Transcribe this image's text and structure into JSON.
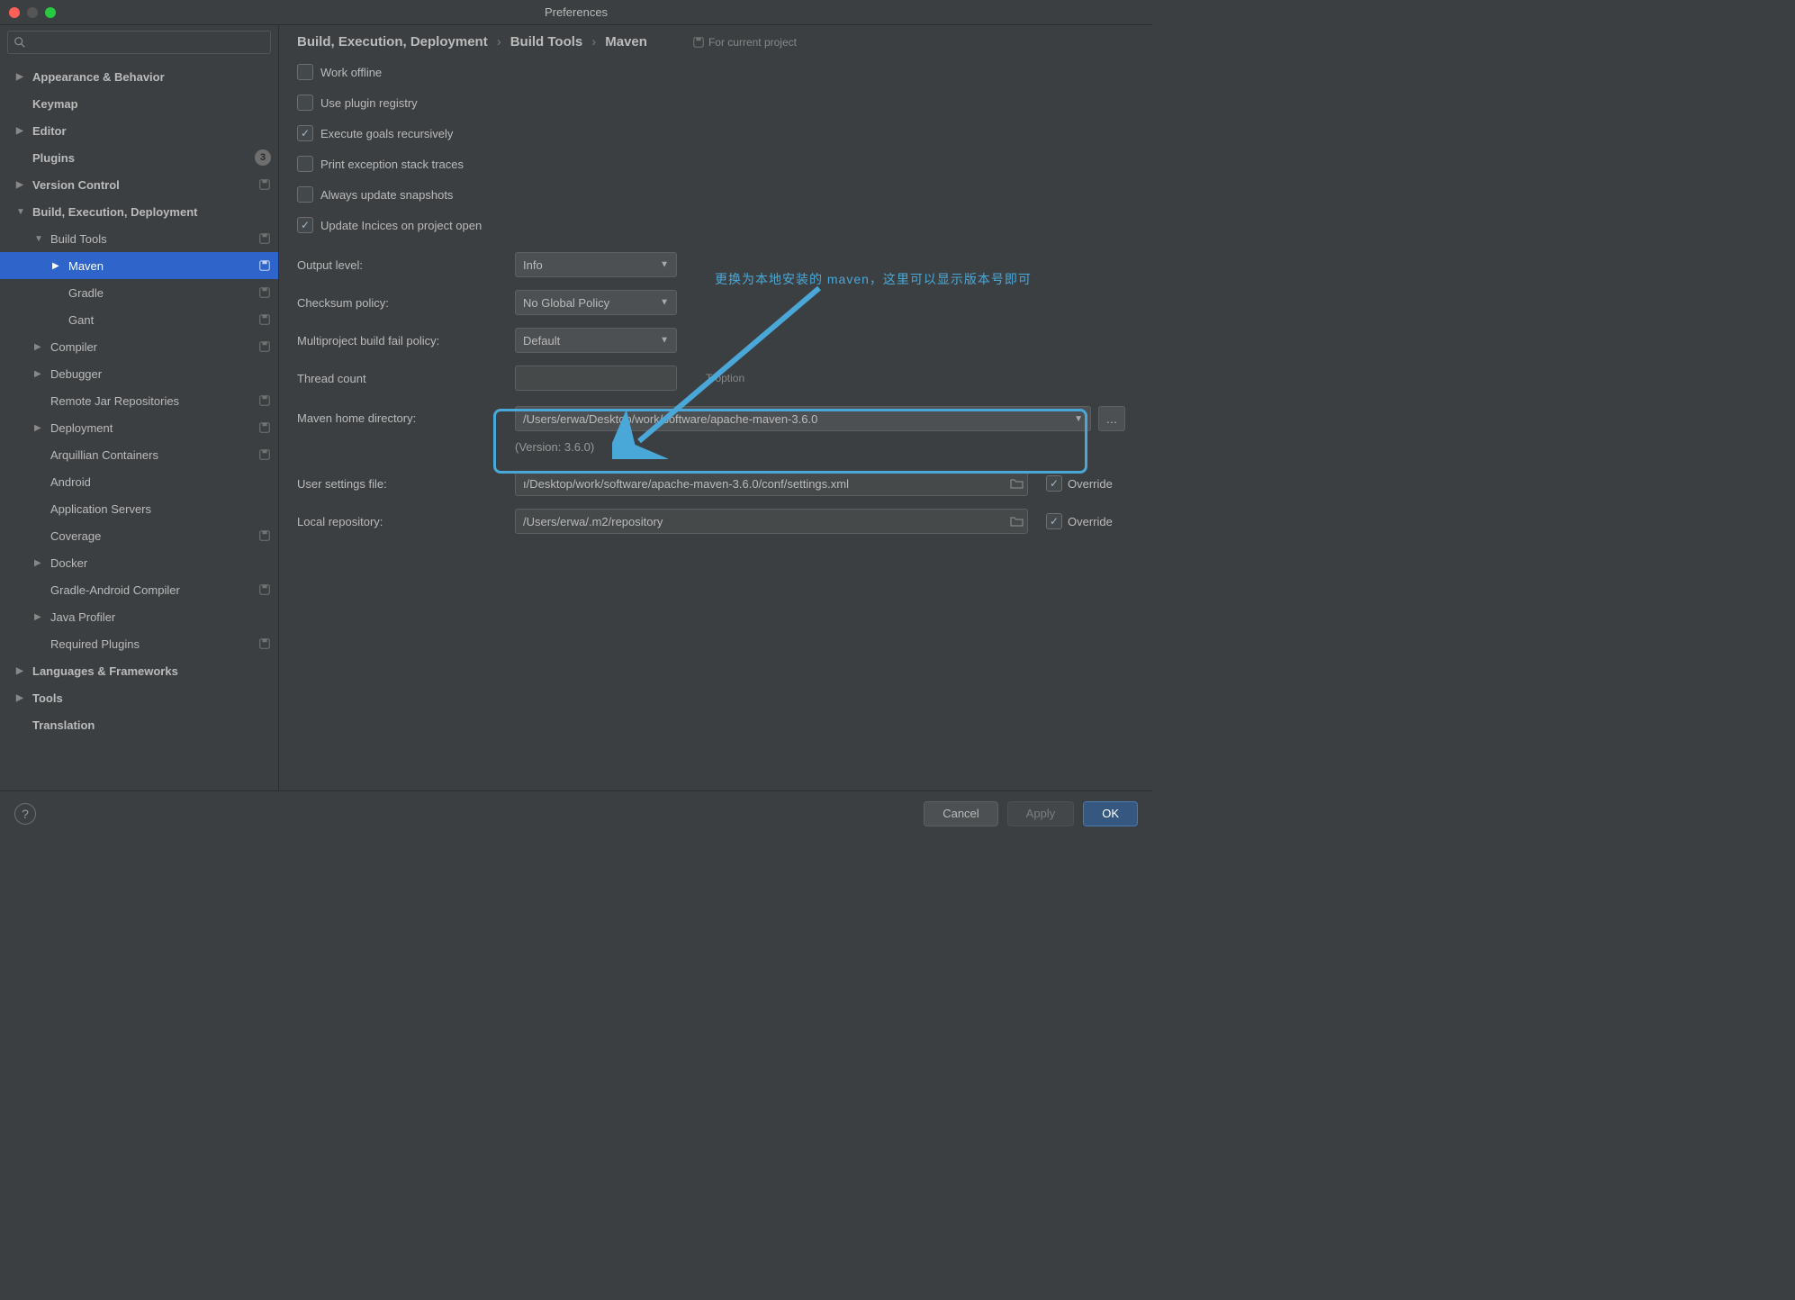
{
  "window": {
    "title": "Preferences"
  },
  "search": {
    "placeholder": ""
  },
  "sidebar": [
    {
      "label": "Appearance & Behavior",
      "expand": "▶",
      "bold": true,
      "level": 0
    },
    {
      "label": "Keymap",
      "bold": true,
      "level": 0
    },
    {
      "label": "Editor",
      "expand": "▶",
      "bold": true,
      "level": 0
    },
    {
      "label": "Plugins",
      "bold": true,
      "level": 0,
      "badge": "3"
    },
    {
      "label": "Version Control",
      "expand": "▶",
      "bold": true,
      "level": 0,
      "proj": true
    },
    {
      "label": "Build, Execution, Deployment",
      "expand": "▼",
      "bold": true,
      "level": 0
    },
    {
      "label": "Build Tools",
      "expand": "▼",
      "level": 1,
      "proj": true
    },
    {
      "label": "Maven",
      "expand": "▶",
      "level": 2,
      "selected": true,
      "proj": true
    },
    {
      "label": "Gradle",
      "level": 2,
      "proj": true
    },
    {
      "label": "Gant",
      "level": 2,
      "proj": true
    },
    {
      "label": "Compiler",
      "expand": "▶",
      "level": 1,
      "proj": true
    },
    {
      "label": "Debugger",
      "expand": "▶",
      "level": 1
    },
    {
      "label": "Remote Jar Repositories",
      "level": 1,
      "proj": true
    },
    {
      "label": "Deployment",
      "expand": "▶",
      "level": 1,
      "proj": true
    },
    {
      "label": "Arquillian Containers",
      "level": 1,
      "proj": true
    },
    {
      "label": "Android",
      "level": 1
    },
    {
      "label": "Application Servers",
      "level": 1
    },
    {
      "label": "Coverage",
      "level": 1,
      "proj": true
    },
    {
      "label": "Docker",
      "expand": "▶",
      "level": 1
    },
    {
      "label": "Gradle-Android Compiler",
      "level": 1,
      "proj": true
    },
    {
      "label": "Java Profiler",
      "expand": "▶",
      "level": 1
    },
    {
      "label": "Required Plugins",
      "level": 1,
      "proj": true
    },
    {
      "label": "Languages & Frameworks",
      "expand": "▶",
      "bold": true,
      "level": 0
    },
    {
      "label": "Tools",
      "expand": "▶",
      "bold": true,
      "level": 0
    },
    {
      "label": "Translation",
      "bold": true,
      "level": 0
    }
  ],
  "breadcrumb": {
    "0": "Build, Execution, Deployment",
    "1": "Build Tools",
    "2": "Maven",
    "tag": "For current project"
  },
  "checks": {
    "work_offline": "Work offline",
    "use_plugin_registry": "Use plugin registry",
    "execute_recursive": "Execute goals recursively",
    "print_stack": "Print exception stack traces",
    "always_update": "Always update snapshots",
    "update_indices": "Update Incices on project open"
  },
  "labels": {
    "output_level": "Output level:",
    "checksum": "Checksum policy:",
    "multiproject": "Multiproject build fail policy:",
    "thread_count": "Thread count",
    "t_option": "T option",
    "maven_home": "Maven home directory:",
    "user_settings": "User settings file:",
    "local_repo": "Local repository:",
    "override": "Override"
  },
  "values": {
    "output_level": "Info",
    "checksum": "No Global Policy",
    "multiproject": "Default",
    "thread_count": "",
    "maven_home": "/Users/erwa/Desktop/work/software/apache-maven-3.6.0",
    "version": "(Version: 3.6.0)",
    "user_settings": "ı/Desktop/work/software/apache-maven-3.6.0/conf/settings.xml",
    "local_repo": "/Users/erwa/.m2/repository"
  },
  "annotation": {
    "text": "更换为本地安装的 maven，这里可以显示版本号即可"
  },
  "footer": {
    "help": "?",
    "cancel": "Cancel",
    "apply": "Apply",
    "ok": "OK"
  }
}
